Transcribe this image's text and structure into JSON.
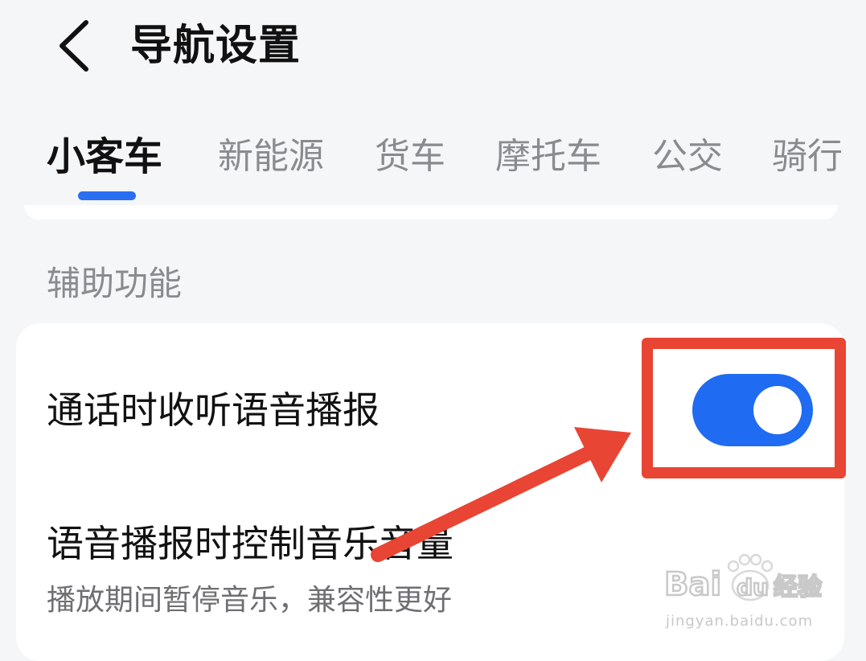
{
  "header": {
    "title": "导航设置",
    "back_icon": "chevron-left-icon"
  },
  "tabs": [
    {
      "label": "小客车",
      "active": true
    },
    {
      "label": "新能源",
      "active": false
    },
    {
      "label": "货车",
      "active": false
    },
    {
      "label": "摩托车",
      "active": false
    },
    {
      "label": "公交",
      "active": false
    },
    {
      "label": "骑行",
      "active": false
    }
  ],
  "section": {
    "title": "辅助功能"
  },
  "settings": [
    {
      "label": "通话时收听语音播报",
      "toggle_on": true
    },
    {
      "label": "语音播报时控制音乐音量",
      "subtitle": "播放期间暂停音乐，兼容性更好"
    }
  ],
  "colors": {
    "accent": "#1f6bf2",
    "highlight": "#e84534",
    "background": "#f5f6f8"
  },
  "watermark": {
    "logo_text": "Bai du 经验",
    "url": "jingyan.baidu.com"
  }
}
